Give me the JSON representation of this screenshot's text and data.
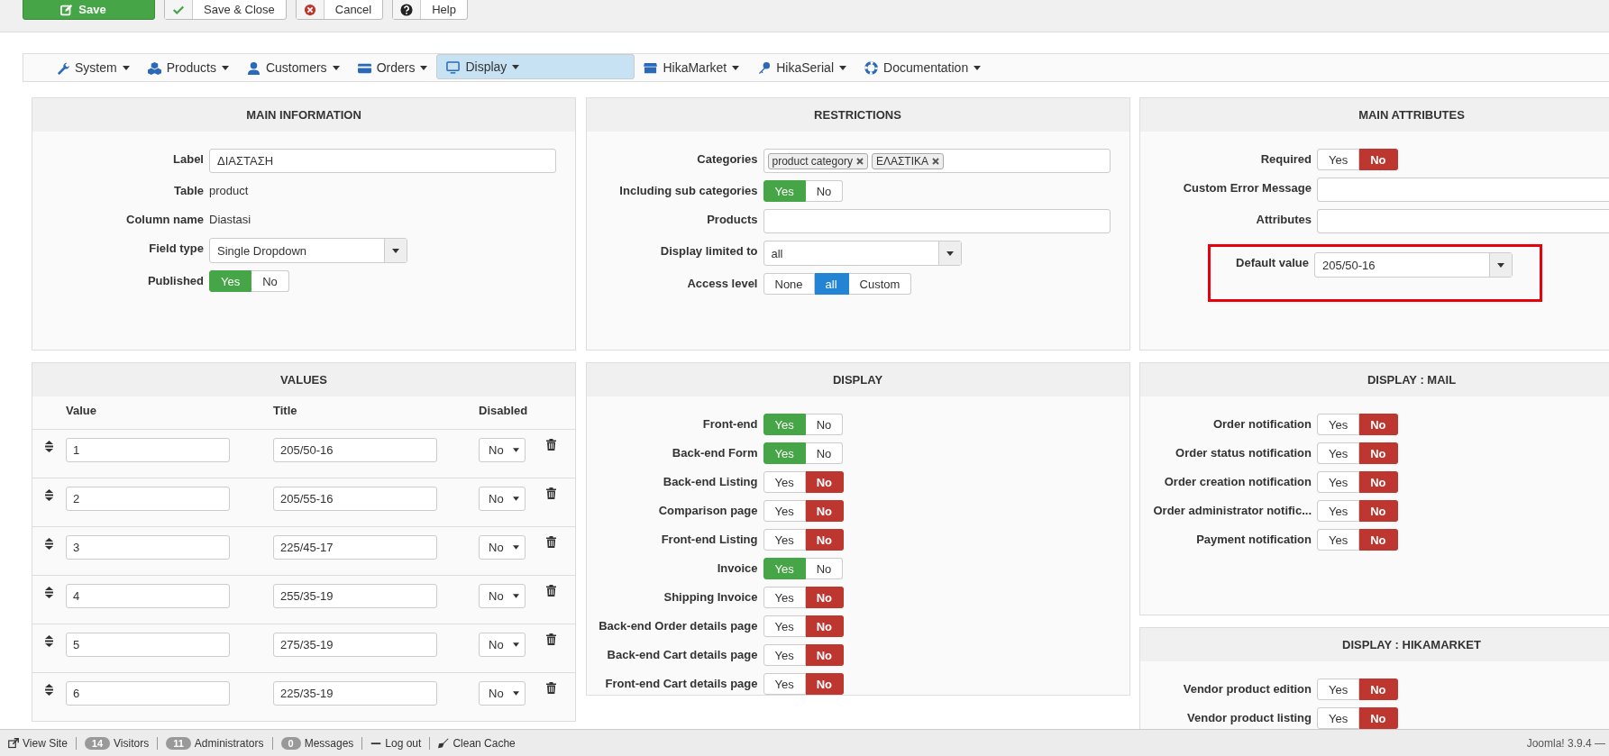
{
  "toolbar": {
    "buttons": [
      {
        "label": "Save",
        "kind": "primary"
      },
      {
        "label": "Save & Close",
        "kind": "default"
      },
      {
        "label": "Cancel",
        "kind": "default"
      },
      {
        "label": "Help",
        "kind": "default"
      }
    ]
  },
  "menu": [
    {
      "label": "System",
      "selected": false
    },
    {
      "label": "Products",
      "selected": false
    },
    {
      "label": "Customers",
      "selected": false
    },
    {
      "label": "Orders",
      "selected": false
    },
    {
      "label": "Display",
      "selected": true
    },
    {
      "label": "HikaMarket",
      "selected": false
    },
    {
      "label": "HikaSerial",
      "selected": false
    },
    {
      "label": "Documentation",
      "selected": false
    }
  ],
  "main_information": {
    "title": "MAIN INFORMATION",
    "fields": [
      {
        "label": "Label",
        "kind": "input",
        "value": "ΔΙΑΣΤΑΣΗ"
      },
      {
        "label": "Table",
        "kind": "text",
        "value": "product"
      },
      {
        "label": "Column name",
        "kind": "text",
        "value": "Diastasi"
      },
      {
        "label": "Field type",
        "kind": "select",
        "value": "Single Dropdown"
      },
      {
        "label": "Published",
        "kind": "toggle",
        "options": [
          {
            "label": "Yes",
            "selected": true
          },
          {
            "label": "No",
            "selected": false
          }
        ]
      }
    ]
  },
  "restrictions": {
    "title": "RESTRICTIONS",
    "fields": [
      {
        "label": "Categories",
        "kind": "tags",
        "tags": [
          "product category",
          "ΕΛΑΣΤΙΚΑ"
        ]
      },
      {
        "label": "Including sub categories",
        "kind": "toggle",
        "options": [
          {
            "label": "Yes",
            "selected": true
          },
          {
            "label": "No",
            "selected": false
          }
        ]
      },
      {
        "label": "Products",
        "kind": "input"
      },
      {
        "label": "Display limited to",
        "kind": "select",
        "value": "all"
      },
      {
        "label": "Access level",
        "kind": "toggle",
        "options": [
          {
            "label": "None",
            "selected": false
          },
          {
            "label": "all",
            "selected": true
          },
          {
            "label": "Custom",
            "selected": false
          }
        ]
      }
    ]
  },
  "main_attributes": {
    "title": "MAIN ATTRIBUTES",
    "fields": [
      {
        "label": "Required",
        "kind": "toggle",
        "options": [
          {
            "label": "Yes",
            "selected": false
          },
          {
            "label": "No",
            "selected": true
          }
        ]
      },
      {
        "label": "Custom Error Message",
        "kind": "input"
      },
      {
        "label": "Attributes",
        "kind": "input"
      },
      {
        "label": "Default value",
        "kind": "select",
        "value": "205/50-16",
        "highlighted": true
      }
    ]
  },
  "values": {
    "title": "VALUES",
    "columns": [
      "Value",
      "Title",
      "Disabled"
    ],
    "rows": [
      {
        "value": "1",
        "title": "205/50-16",
        "disabled": "No"
      },
      {
        "value": "2",
        "title": "205/55-16",
        "disabled": "No"
      },
      {
        "value": "3",
        "title": "225/45-17",
        "disabled": "No"
      },
      {
        "value": "4",
        "title": "255/35-19",
        "disabled": "No"
      },
      {
        "value": "5",
        "title": "275/35-19",
        "disabled": "No"
      },
      {
        "value": "6",
        "title": "225/35-19",
        "disabled": "No"
      }
    ]
  },
  "display": {
    "title": "DISPLAY",
    "fields": [
      {
        "label": "Front-end",
        "kind": "toggle",
        "options": [
          {
            "label": "Yes",
            "selected": true
          },
          {
            "label": "No",
            "selected": false
          }
        ]
      },
      {
        "label": "Back-end Form",
        "kind": "toggle",
        "options": [
          {
            "label": "Yes",
            "selected": true
          },
          {
            "label": "No",
            "selected": false
          }
        ]
      },
      {
        "label": "Back-end Listing",
        "kind": "toggle",
        "options": [
          {
            "label": "Yes",
            "selected": false
          },
          {
            "label": "No",
            "selected": true
          }
        ]
      },
      {
        "label": "Comparison page",
        "kind": "toggle",
        "options": [
          {
            "label": "Yes",
            "selected": false
          },
          {
            "label": "No",
            "selected": true
          }
        ]
      },
      {
        "label": "Front-end Listing",
        "kind": "toggle",
        "options": [
          {
            "label": "Yes",
            "selected": false
          },
          {
            "label": "No",
            "selected": true
          }
        ]
      },
      {
        "label": "Invoice",
        "kind": "toggle",
        "options": [
          {
            "label": "Yes",
            "selected": true
          },
          {
            "label": "No",
            "selected": false
          }
        ]
      },
      {
        "label": "Shipping Invoice",
        "kind": "toggle",
        "options": [
          {
            "label": "Yes",
            "selected": false
          },
          {
            "label": "No",
            "selected": true
          }
        ]
      },
      {
        "label": "Back-end Order details page",
        "kind": "toggle",
        "options": [
          {
            "label": "Yes",
            "selected": false
          },
          {
            "label": "No",
            "selected": true
          }
        ]
      },
      {
        "label": "Back-end Cart details page",
        "kind": "toggle",
        "options": [
          {
            "label": "Yes",
            "selected": false
          },
          {
            "label": "No",
            "selected": true
          }
        ]
      },
      {
        "label": "Front-end Cart details page",
        "kind": "toggle",
        "options": [
          {
            "label": "Yes",
            "selected": false
          },
          {
            "label": "No",
            "selected": true
          }
        ]
      }
    ]
  },
  "display_mail": {
    "title": "DISPLAY : MAIL",
    "fields": [
      {
        "label": "Order notification",
        "kind": "toggle",
        "options": [
          {
            "label": "Yes",
            "selected": false
          },
          {
            "label": "No",
            "selected": true
          }
        ]
      },
      {
        "label": "Order status notification",
        "kind": "toggle",
        "options": [
          {
            "label": "Yes",
            "selected": false
          },
          {
            "label": "No",
            "selected": true
          }
        ]
      },
      {
        "label": "Order creation notification",
        "kind": "toggle",
        "options": [
          {
            "label": "Yes",
            "selected": false
          },
          {
            "label": "No",
            "selected": true
          }
        ]
      },
      {
        "label": "Order administrator notific...",
        "kind": "toggle",
        "options": [
          {
            "label": "Yes",
            "selected": false
          },
          {
            "label": "No",
            "selected": true
          }
        ]
      },
      {
        "label": "Payment notification",
        "kind": "toggle",
        "options": [
          {
            "label": "Yes",
            "selected": false
          },
          {
            "label": "No",
            "selected": true
          }
        ]
      }
    ]
  },
  "display_hikamarket": {
    "title": "DISPLAY : HIKAMARKET",
    "fields": [
      {
        "label": "Vendor product edition",
        "kind": "toggle",
        "options": [
          {
            "label": "Yes",
            "selected": false
          },
          {
            "label": "No",
            "selected": true
          }
        ]
      },
      {
        "label": "Vendor product listing",
        "kind": "toggle",
        "options": [
          {
            "label": "Yes",
            "selected": false
          },
          {
            "label": "No",
            "selected": true
          }
        ]
      }
    ]
  },
  "status_bar": {
    "items": [
      {
        "kind": "link",
        "label": "View Site"
      },
      {
        "kind": "badge",
        "count": "14",
        "label": "Visitors"
      },
      {
        "kind": "badge",
        "count": "11",
        "label": "Administrators"
      },
      {
        "kind": "badge",
        "count": "0",
        "label": "Messages"
      },
      {
        "kind": "link",
        "label": "Log out"
      },
      {
        "kind": "link",
        "label": "Clean Cache"
      }
    ],
    "version": "Joomla! 3.9.4 —"
  }
}
